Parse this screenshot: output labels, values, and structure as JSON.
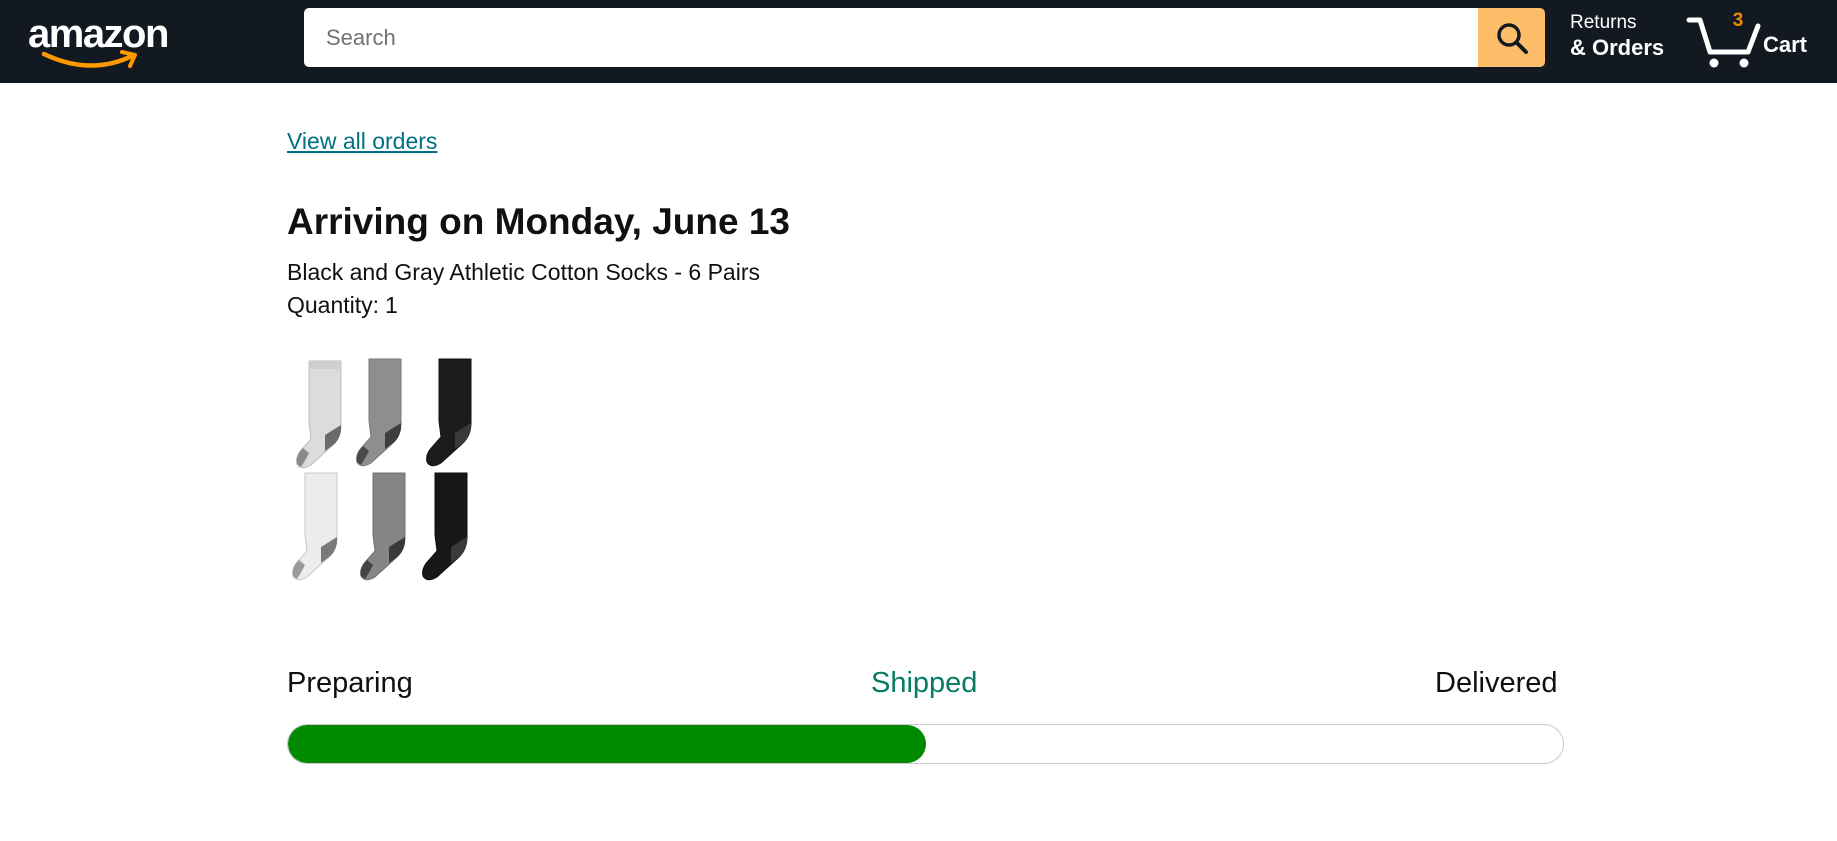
{
  "header": {
    "logo_text": "amazon",
    "search": {
      "placeholder": "Search",
      "value": ""
    },
    "returns": {
      "line1": "Returns",
      "line2": "& Orders"
    },
    "cart": {
      "count": "3",
      "label": "Cart"
    }
  },
  "main": {
    "view_all_link": "View all orders",
    "arrival_title": "Arriving on Monday, June 13",
    "product_name": "Black and Gray Athletic Cotton Socks - 6 Pairs",
    "quantity_label": "Quantity:",
    "quantity_value": "1"
  },
  "tracker": {
    "steps": [
      "Preparing",
      "Shipped",
      "Delivered"
    ],
    "current_step": "Shipped",
    "progress_fraction": 0.5
  },
  "icons": {
    "search": "search-icon",
    "cart": "cart-icon",
    "logo_smile": "amazon-smile-arrow"
  },
  "colors": {
    "header_bg": "#131921",
    "search_button": "#febd69",
    "cart_count": "#f08804",
    "link": "#007185",
    "shipped_text": "#067d62",
    "progress_fill": "#008a00"
  }
}
